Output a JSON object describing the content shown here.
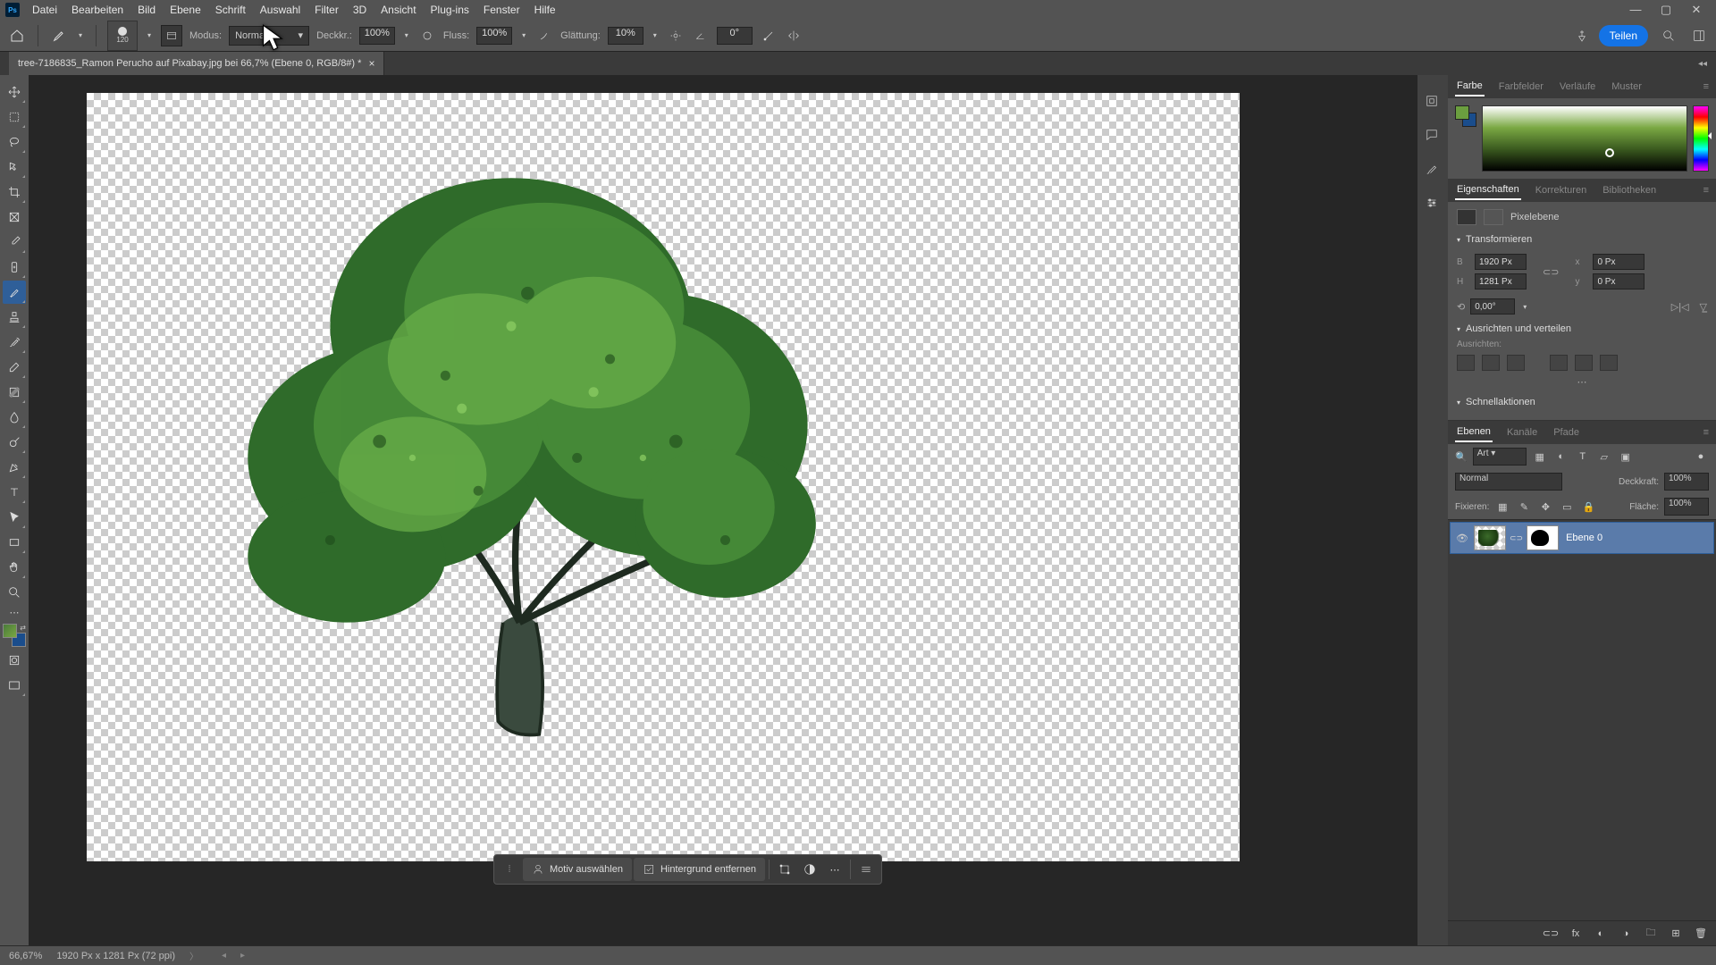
{
  "menubar": {
    "items": [
      "Datei",
      "Bearbeiten",
      "Bild",
      "Ebene",
      "Schrift",
      "Auswahl",
      "Filter",
      "3D",
      "Ansicht",
      "Plug-ins",
      "Fenster",
      "Hilfe"
    ]
  },
  "options": {
    "brush_size": "120",
    "mode_label": "Modus:",
    "mode_value": "Normal",
    "opacity_label": "Deckkr.:",
    "opacity_value": "100%",
    "flow_label": "Fluss:",
    "flow_value": "100%",
    "smooth_label": "Glättung:",
    "smooth_value": "10%",
    "angle_value": "0°",
    "share_label": "Teilen"
  },
  "doc_tab": {
    "label": "tree-7186835_Ramon Perucho auf Pixabay.jpg bei 66,7% (Ebene 0, RGB/8#) *"
  },
  "properties": {
    "tabs": [
      "Eigenschaften",
      "Korrekturen",
      "Bibliotheken"
    ],
    "layer_type": "Pixelebene",
    "transform": {
      "header": "Transformieren",
      "w_label": "B",
      "w_value": "1920 Px",
      "h_label": "H",
      "h_value": "1281 Px",
      "x_label": "x",
      "x_value": "0 Px",
      "y_label": "y",
      "y_value": "0 Px",
      "angle_value": "0,00°"
    },
    "align_header": "Ausrichten und verteilen",
    "align_label": "Ausrichten:",
    "quick_header": "Schnellaktionen"
  },
  "color_panel": {
    "tabs": [
      "Farbe",
      "Farbfelder",
      "Verläufe",
      "Muster"
    ]
  },
  "layers": {
    "tabs": [
      "Ebenen",
      "Kanäle",
      "Pfade"
    ],
    "filter_label": "Art",
    "blend_mode": "Normal",
    "opacity_label": "Deckkraft:",
    "opacity_value": "100%",
    "lock_label": "Fixieren:",
    "fill_label": "Fläche:",
    "fill_value": "100%",
    "layer0_name": "Ebene 0"
  },
  "quickbar": {
    "select_subject": "Motiv auswählen",
    "remove_bg": "Hintergrund entfernen"
  },
  "status": {
    "zoom": "66,67%",
    "dims": "1920 Px x 1281 Px (72 ppi)"
  }
}
